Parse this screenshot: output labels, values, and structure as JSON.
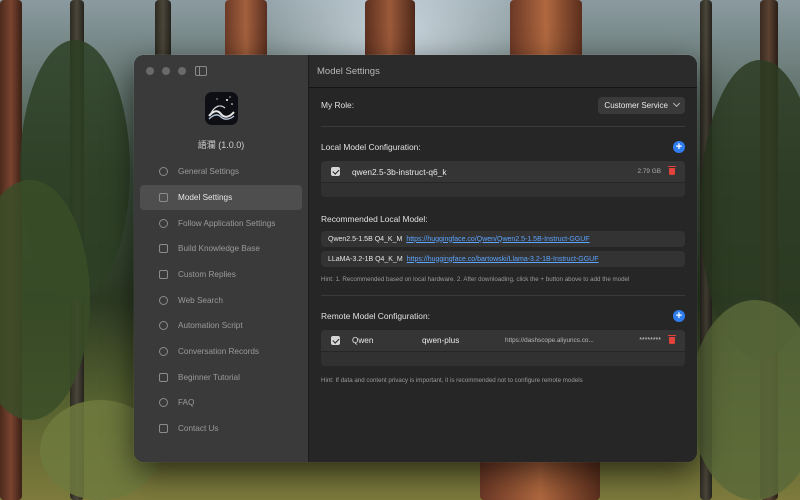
{
  "window": {
    "header_title": "Model Settings"
  },
  "app": {
    "title": "語瀾 (1.0.0)"
  },
  "sidebar": {
    "items": [
      {
        "label": "General Settings",
        "icon": "gear-icon",
        "active": false
      },
      {
        "label": "Model Settings",
        "icon": "chip-icon",
        "active": true
      },
      {
        "label": "Follow Application Settings",
        "icon": "refresh-icon",
        "active": false
      },
      {
        "label": "Build Knowledge Base",
        "icon": "book-icon",
        "active": false
      },
      {
        "label": "Custom Replies",
        "icon": "reply-icon",
        "active": false
      },
      {
        "label": "Web Search",
        "icon": "globe-icon",
        "active": false
      },
      {
        "label": "Automation Script",
        "icon": "script-icon",
        "active": false
      },
      {
        "label": "Conversation Records",
        "icon": "chat-icon",
        "active": false
      },
      {
        "label": "Beginner Tutorial",
        "icon": "tutorial-icon",
        "active": false
      },
      {
        "label": "FAQ",
        "icon": "question-icon",
        "active": false
      },
      {
        "label": "Contact Us",
        "icon": "mail-icon",
        "active": false
      }
    ]
  },
  "role": {
    "label": "My Role:",
    "value": "Customer Service"
  },
  "local": {
    "label": "Local Model Configuration:",
    "model_name": "qwen2.5-3b-instruct-q6_k",
    "model_size": "2.79 GB",
    "checked": true
  },
  "recommended": {
    "label": "Recommended Local Model:",
    "items": [
      {
        "name": "Qwen2.5-1.5B Q4_K_M",
        "link": "https://huggingface.co/Qwen/Qwen2.5-1.5B-Instruct-GGUF"
      },
      {
        "name": "LLaMA-3.2-1B Q4_K_M",
        "link": "https://huggingface.co/bartowski/Llama-3.2-1B-Instruct-GGUF"
      }
    ],
    "hint": "Hint: 1. Recommended based on local hardware. 2. After downloading, click the + button above to add the model"
  },
  "remote": {
    "label": "Remote Model Configuration:",
    "provider": "Qwen",
    "model": "qwen-plus",
    "url": "https://dashscope.aliyuncs.co...",
    "key": "********",
    "checked": true,
    "hint": "Hint: If data and content privacy is important, it is recommended not to configure remote models"
  },
  "colors": {
    "accent": "#2f7df0",
    "link": "#5ba3ff",
    "danger": "#e0433b"
  }
}
